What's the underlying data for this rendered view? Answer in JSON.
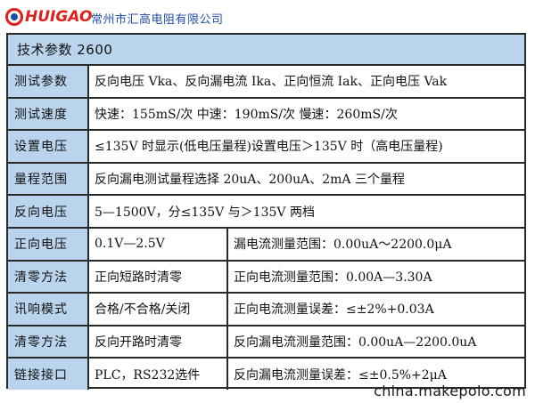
{
  "header": {
    "logo_text": "HUIGAO",
    "company_name": "常州市汇高电阻有限公司"
  },
  "table": {
    "title": "技术参数 2600",
    "rows": [
      {
        "label": "测试参数",
        "value": "反向电压 Vka、反向漏电流 Ika、正向恒流 Iak、正向电压 Vak"
      },
      {
        "label": "测试速度",
        "value": "快速：155mS/次 中速：190mS/次  慢速：260mS/次"
      },
      {
        "label": "设置电压",
        "value": "≤135V 时显示(低电压量程)设置电压＞135V 时（高电压量程)"
      },
      {
        "label": "量程范围",
        "value": "反向漏电测试量程选择 20uA、200uA、2mA 三个量程"
      },
      {
        "label": "反向电压",
        "value": "5—1500V，分≤135V 与＞135V 两档"
      },
      {
        "label": "正向电压",
        "value": "0.1V—2.5V",
        "value2": "漏电流测量范围：0.00uA～2200.0μA"
      },
      {
        "label": "清零方法",
        "value": "正向短路时清零",
        "value2": "正向电流测量范围：0.00A—3.30A"
      },
      {
        "label": "讯响模式",
        "value": "合格/不合格/关闭",
        "value2": "正向电流测量误差：≤±2%+0.03A"
      },
      {
        "label": "清零方法",
        "value": "反向开路时清零",
        "value2": "反向漏电流测量范围：0.00uA—2200.0uA"
      },
      {
        "label": "链接接口",
        "value": "PLC，RS232选件",
        "value2": "反向漏电流测量误差：≤±0.5%+2μA"
      }
    ]
  },
  "footer": {
    "source": "china.makepolo.com"
  },
  "colors": {
    "label_bg": "#b9d4ec",
    "brand_red": "#e0201a",
    "brand_blue": "#1f4fa8"
  }
}
